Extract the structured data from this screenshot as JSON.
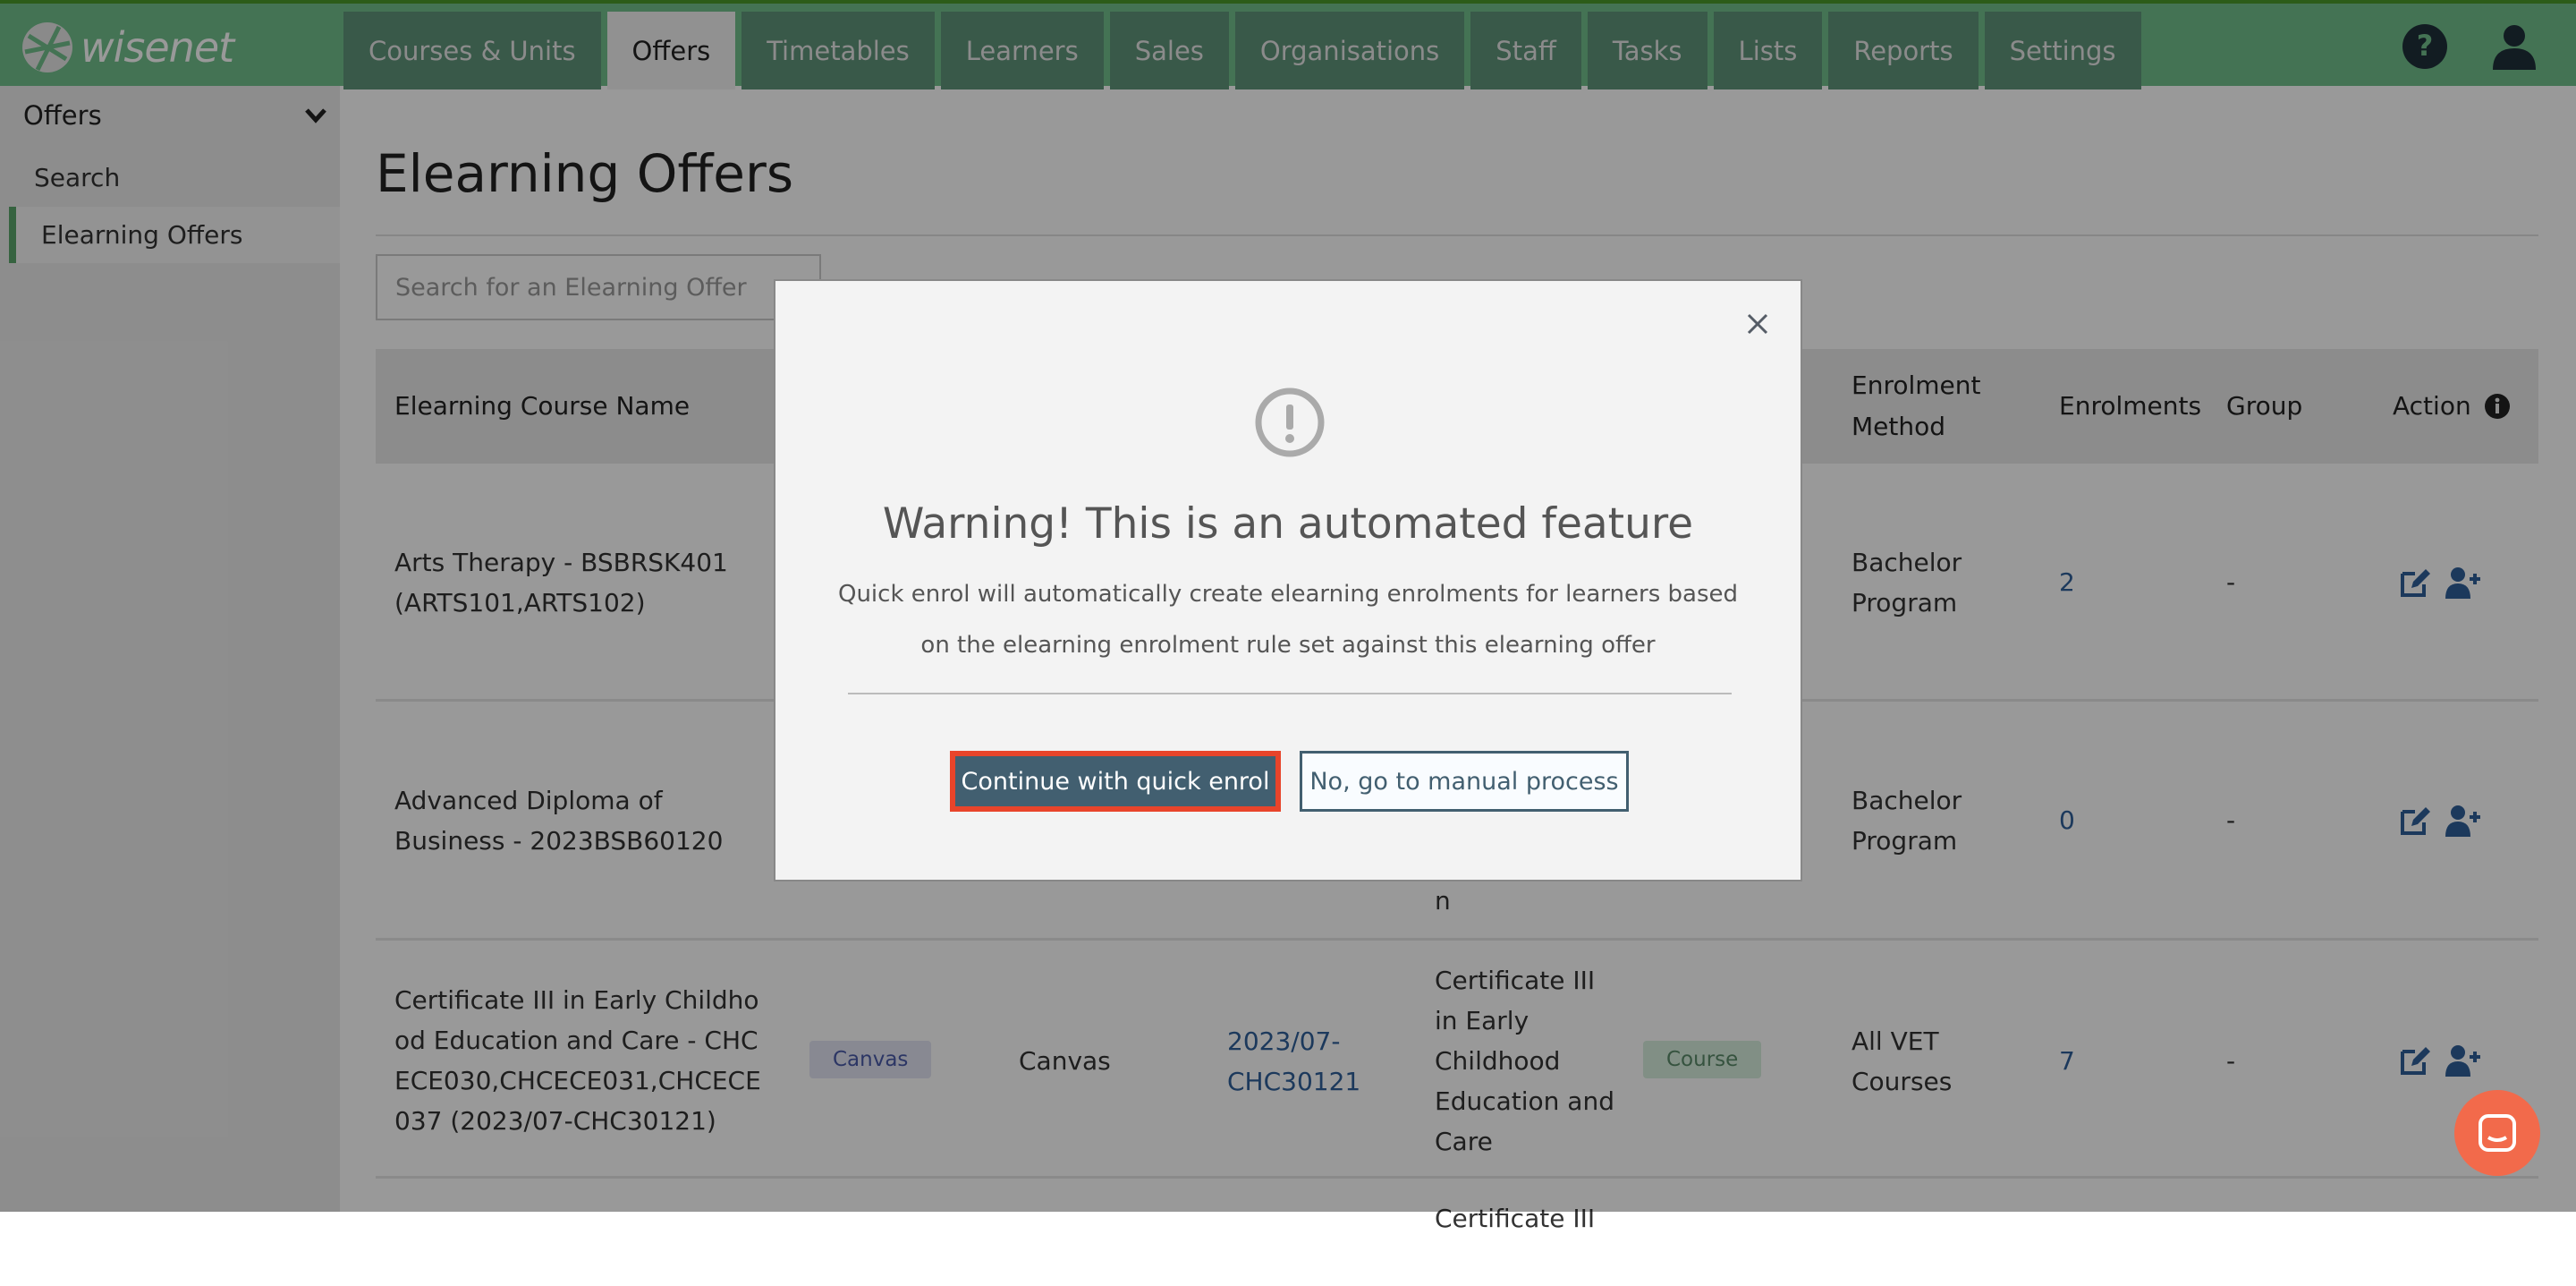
{
  "brand": {
    "logo_text": "wisenet",
    "green": "#72c08c",
    "chat_color": "#f26a4b"
  },
  "nav": {
    "tabs": [
      "Courses & Units",
      "Offers",
      "Timetables",
      "Learners",
      "Sales",
      "Organisations",
      "Staff",
      "Tasks",
      "Lists",
      "Reports",
      "Settings"
    ],
    "active": "Offers",
    "help_icon": "question-circle-icon",
    "user_icon": "user-icon"
  },
  "sidebar": {
    "section": "Offers",
    "items": [
      {
        "label": "Search"
      },
      {
        "label": "Elearning Offers",
        "active": true
      }
    ]
  },
  "page": {
    "title": "Elearning Offers",
    "search_placeholder": "Search for an Elearning Offer"
  },
  "table": {
    "headers": {
      "name": "Elearning Course Name",
      "method": "Enrolment Method",
      "enrolments": "Enrolments",
      "group": "Group",
      "action": "Action"
    },
    "rows": [
      {
        "name": "Arts Therapy - BSBRSK401 (ARTS101,ARTS102)",
        "method": "Bachelor Program",
        "enrolments": "2",
        "group": "-"
      },
      {
        "name": "Advanced Diploma of Business - 2023BSB60120",
        "col5_tail": "n",
        "method": "Bachelor Program",
        "enrolments": "0",
        "group": "-"
      },
      {
        "name": "Certificate III in Early Childhood Education and Care - CHCECE030,CHCECE031,CHCECE037 (2023/07-CHC30121)",
        "lms_badge": "Canvas",
        "lms": "Canvas",
        "offer_link": "2023/07-CHC30121",
        "course_name": "Certificate III in Early Childhood Education and Care",
        "type_badge": "Course",
        "method": "All VET Courses",
        "enrolments": "7",
        "group": "-"
      },
      {
        "course_name": "Certificate III"
      }
    ]
  },
  "modal": {
    "title": "Warning! This is an automated feature",
    "text": "Quick enrol will automatically create elearning enrolments for learners based on the elearning enrolment rule set against this elearning offer",
    "primary": "Continue with quick enrol",
    "secondary": "No, go to manual process"
  }
}
